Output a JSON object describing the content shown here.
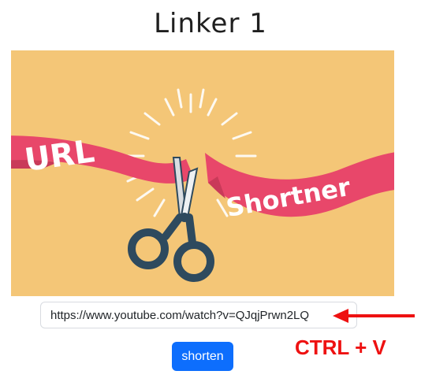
{
  "page": {
    "title": "Linker 1"
  },
  "hero": {
    "banner_text_left": "URL",
    "banner_text_right": "Shortner"
  },
  "form": {
    "url_value": "https://www.youtube.com/watch?v=QJqjPrwn2LQ",
    "submit_label": "shorten"
  },
  "annotation": {
    "text": "CTRL + V",
    "color": "#ee1111"
  },
  "colors": {
    "background": "#f4c677",
    "ribbon": "#e8476a",
    "primary": "#0d6efd",
    "scissors": "#2e4a5e"
  }
}
